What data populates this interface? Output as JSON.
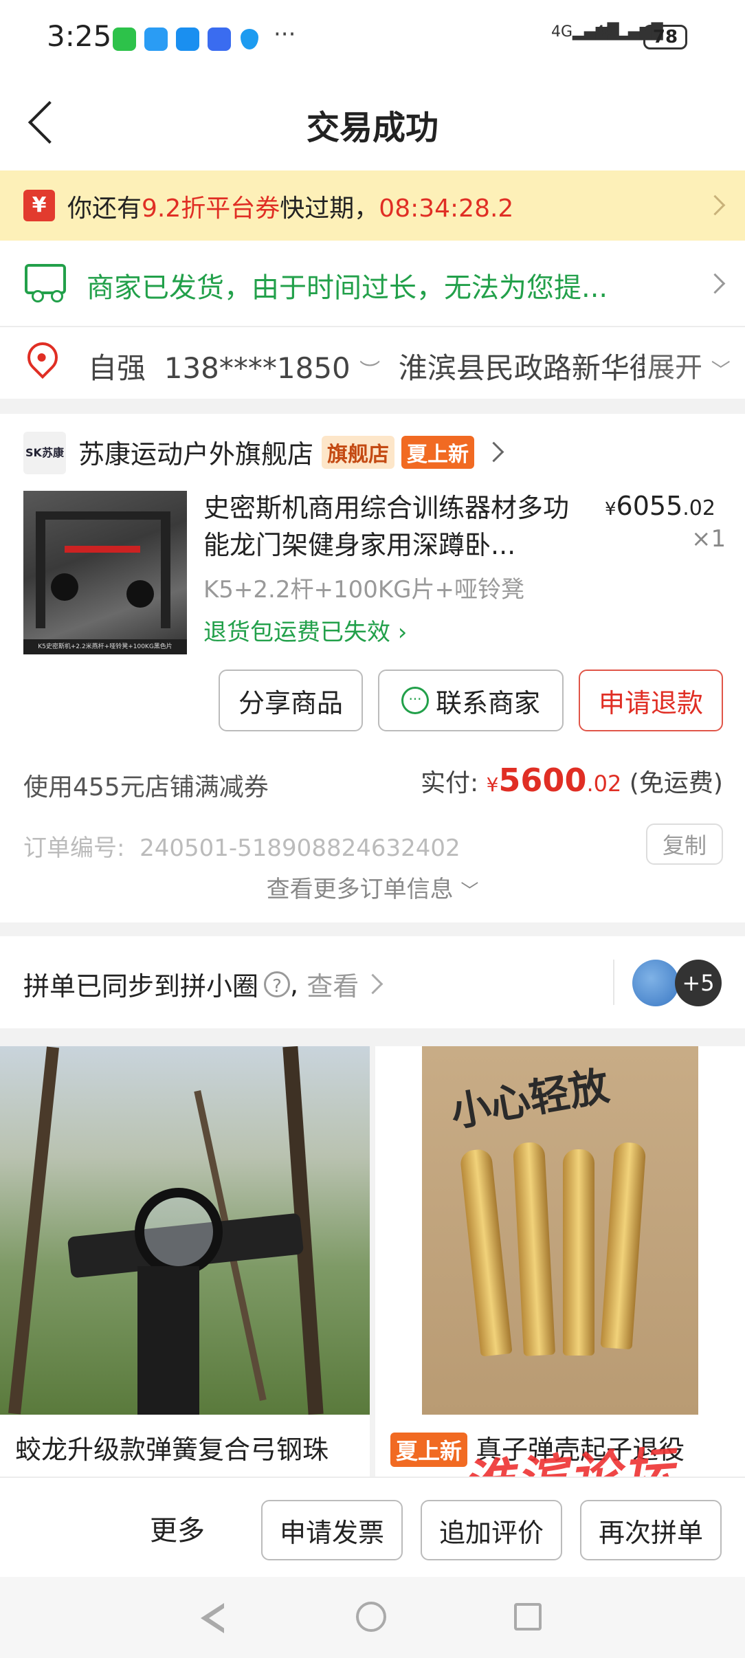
{
  "status_bar": {
    "time": "3:25",
    "battery": "78",
    "signal1": "4G",
    "signal2": "4G"
  },
  "header": {
    "title": "交易成功"
  },
  "coupon_banner": {
    "icon_glyph": "¥",
    "prefix": "你还有",
    "coupon": "9.2折平台券",
    "middle": "快过期，",
    "countdown": "08:34:28.2"
  },
  "shipping": {
    "message": "商家已发货，由于时间过长，无法为您提..."
  },
  "address": {
    "name": "自强",
    "phone": "138****1850",
    "location": "淮滨县民政路新华街",
    "expand": "展开"
  },
  "order": {
    "shop_logo_text": "SK苏康",
    "shop_name": "苏康运动户外旗舰店",
    "badge_flagship": "旗舰店",
    "badge_summer": "夏上新",
    "product_title": "史密斯机商用综合训练器材多功能龙门架健身家用深蹲卧...",
    "price_symbol": "¥",
    "price_int": "6055",
    "price_dec": ".02",
    "quantity": "×1",
    "spec": "K5+2.2杆+100KG片+哑铃凳",
    "return_status": "退货包运费已失效",
    "image_caption": "K5史密斯机+2.2米燕杆+哑铃凳+100KG黑色片",
    "buttons": {
      "share": "分享商品",
      "contact": "联系商家",
      "refund": "申请退款"
    },
    "discount_text": "使用455元店铺满减券",
    "paid_label": "实付:",
    "paid_symbol": "¥",
    "paid_int": "5600",
    "paid_dec": ".02",
    "shipping_fee": "(免运费)",
    "order_no_label": "订单编号:",
    "order_no": "240501-518908824632402",
    "copy": "复制",
    "more_info": "查看更多订单信息"
  },
  "pindan": {
    "text": "拼单已同步到拼小圈",
    "comma": ",",
    "view": "查看",
    "plus": "+5"
  },
  "recommendations": [
    {
      "title": "蛟龙升级款弹簧复合弓钢珠"
    },
    {
      "badge": "夏上新",
      "title": "真子弹壳起子退役",
      "image_text": "小心轻放"
    }
  ],
  "bottom_bar": {
    "more": "更多",
    "invoice": "申请发票",
    "review": "追加评价",
    "rebuy": "再次拼单"
  },
  "watermark": "淮滨论坛",
  "colors": {
    "red": "#e02e24",
    "green": "#22a04a",
    "banner": "#fdf0b8",
    "badge_orange": "#f16a22"
  }
}
